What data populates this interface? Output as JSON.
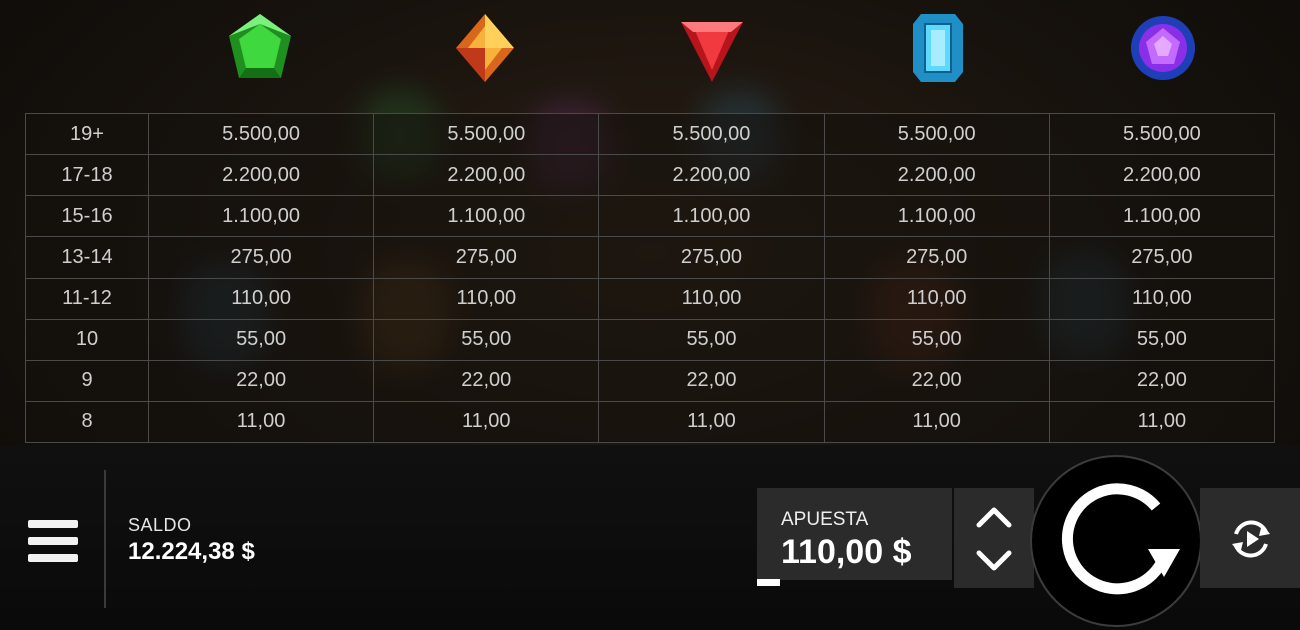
{
  "symbols": [
    {
      "name": "green-gem-icon",
      "color": "#2fcf2f"
    },
    {
      "name": "orange-gem-icon",
      "color": "#f28c1a"
    },
    {
      "name": "red-gem-icon",
      "color": "#e3222a"
    },
    {
      "name": "blue-gem-icon",
      "color": "#3fc6f0"
    },
    {
      "name": "purple-gem-icon",
      "color": "#9b3cf0"
    }
  ],
  "paytable": {
    "rows": [
      {
        "count": "19+",
        "payouts": [
          "5.500,00",
          "5.500,00",
          "5.500,00",
          "5.500,00",
          "5.500,00"
        ]
      },
      {
        "count": "17-18",
        "payouts": [
          "2.200,00",
          "2.200,00",
          "2.200,00",
          "2.200,00",
          "2.200,00"
        ]
      },
      {
        "count": "15-16",
        "payouts": [
          "1.100,00",
          "1.100,00",
          "1.100,00",
          "1.100,00",
          "1.100,00"
        ]
      },
      {
        "count": "13-14",
        "payouts": [
          "275,00",
          "275,00",
          "275,00",
          "275,00",
          "275,00"
        ]
      },
      {
        "count": "11-12",
        "payouts": [
          "110,00",
          "110,00",
          "110,00",
          "110,00",
          "110,00"
        ]
      },
      {
        "count": "10",
        "payouts": [
          "55,00",
          "55,00",
          "55,00",
          "55,00",
          "55,00"
        ]
      },
      {
        "count": "9",
        "payouts": [
          "22,00",
          "22,00",
          "22,00",
          "22,00",
          "22,00"
        ]
      },
      {
        "count": "8",
        "payouts": [
          "11,00",
          "11,00",
          "11,00",
          "11,00",
          "11,00"
        ]
      }
    ]
  },
  "balance": {
    "label": "SALDO",
    "value": "12.224,38 $"
  },
  "bet": {
    "label": "APUESTA",
    "value": "110,00 $"
  },
  "icons": {
    "menu": "hamburger-menu-icon",
    "bet_up": "chevron-up-icon",
    "bet_down": "chevron-down-icon",
    "spin": "spin-arrow-icon",
    "autoplay": "autoplay-icon"
  }
}
